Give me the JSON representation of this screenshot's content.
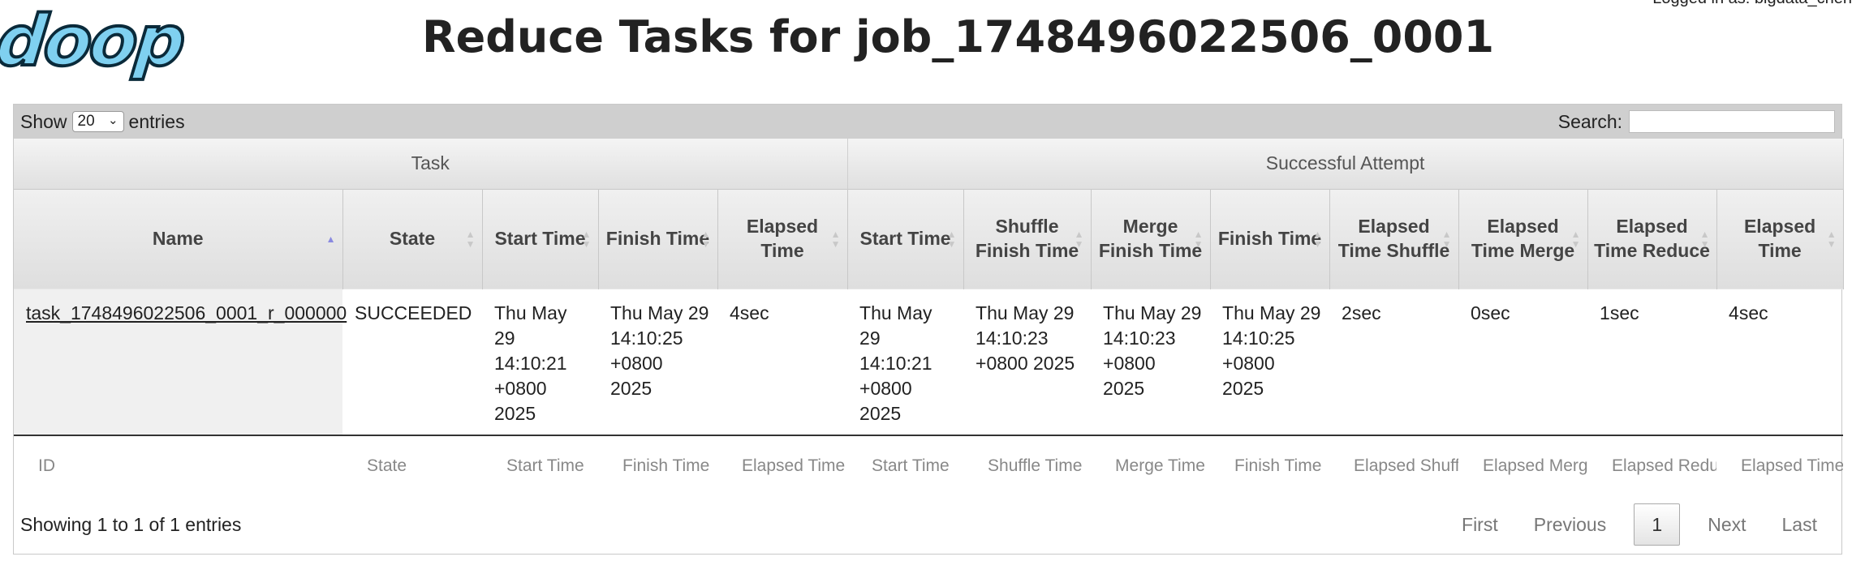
{
  "header": {
    "logo_text": "doop",
    "title": "Reduce Tasks for job_1748496022506_0001",
    "login_text": "Logged in as: bigdata_chen"
  },
  "toolbar": {
    "show_label": "Show",
    "entries_value": "20",
    "entries_label": "entries",
    "search_label": "Search:",
    "search_value": ""
  },
  "groups": {
    "task": "Task",
    "attempt": "Successful Attempt"
  },
  "columns": [
    "Name",
    "State",
    "Start Time",
    "Finish Time",
    "Elapsed Time",
    "Start Time",
    "Shuffle Finish Time",
    "Merge Finish Time",
    "Finish Time",
    "Elapsed Time Shuffle",
    "Elapsed Time Merge",
    "Elapsed Time Reduce",
    "Elapsed Time"
  ],
  "rows": [
    {
      "name": "task_1748496022506_0001_r_000000",
      "state": "SUCCEEDED",
      "start_time": "Thu May 29 14:10:21 +0800 2025",
      "finish_time": "Thu May 29 14:10:25 +0800 2025",
      "elapsed_time": "4sec",
      "attempt_start_time": "Thu May 29 14:10:21 +0800 2025",
      "shuffle_finish_time": "Thu May 29 14:10:23 +0800 2025",
      "merge_finish_time": "Thu May 29 14:10:23 +0800 2025",
      "attempt_finish_time": "Thu May 29 14:10:25 +0800 2025",
      "elapsed_shuffle": "2sec",
      "elapsed_merge": "0sec",
      "elapsed_reduce": "1sec",
      "attempt_elapsed": "4sec"
    }
  ],
  "filters": [
    "ID",
    "State",
    "Start Time",
    "Finish Time",
    "Elapsed Time",
    "Start Time",
    "Shuffle Time",
    "Merge Time",
    "Finish Time",
    "Elapsed Shuffle",
    "Elapsed Merge",
    "Elapsed Reduce",
    "Elapsed Time"
  ],
  "footer": {
    "info": "Showing 1 to 1 of 1 entries",
    "first": "First",
    "previous": "Previous",
    "page": "1",
    "next": "Next",
    "last": "Last"
  }
}
